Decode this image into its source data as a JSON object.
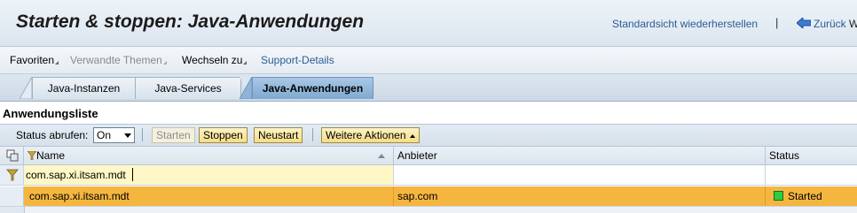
{
  "header": {
    "title": "Starten & stoppen: Java-Anwendungen",
    "restore_view": "Standardsicht wiederherstellen",
    "separator": "|",
    "back": "Zurück",
    "cut_text": "W"
  },
  "menu": {
    "items": [
      "Favoriten",
      "Verwandte Themen",
      "Wechseln zu",
      "Support-Details"
    ]
  },
  "tabs": [
    "Java-Instanzen",
    "Java-Services",
    "Java-Anwendungen"
  ],
  "section": {
    "title": "Anwendungsliste"
  },
  "toolbar": {
    "status_label": "Status abrufen:",
    "status_value": "On",
    "start": "Starten",
    "stop": "Stoppen",
    "restart": "Neustart",
    "more_actions": "Weitere Aktionen"
  },
  "table": {
    "columns": [
      "Name",
      "Anbieter",
      "Status"
    ],
    "filter": {
      "name": "com.sap.xi.itsam.mdt",
      "vendor": "",
      "status": ""
    },
    "rows": [
      {
        "name": "com.sap.xi.itsam.mdt",
        "vendor": "sap.com",
        "status": "Started"
      }
    ]
  },
  "colors": {
    "accent": "#2b5d94",
    "selected_row": "#f5b640",
    "filter_row": "#fff7c6",
    "status_ok": "#2ecc40"
  }
}
